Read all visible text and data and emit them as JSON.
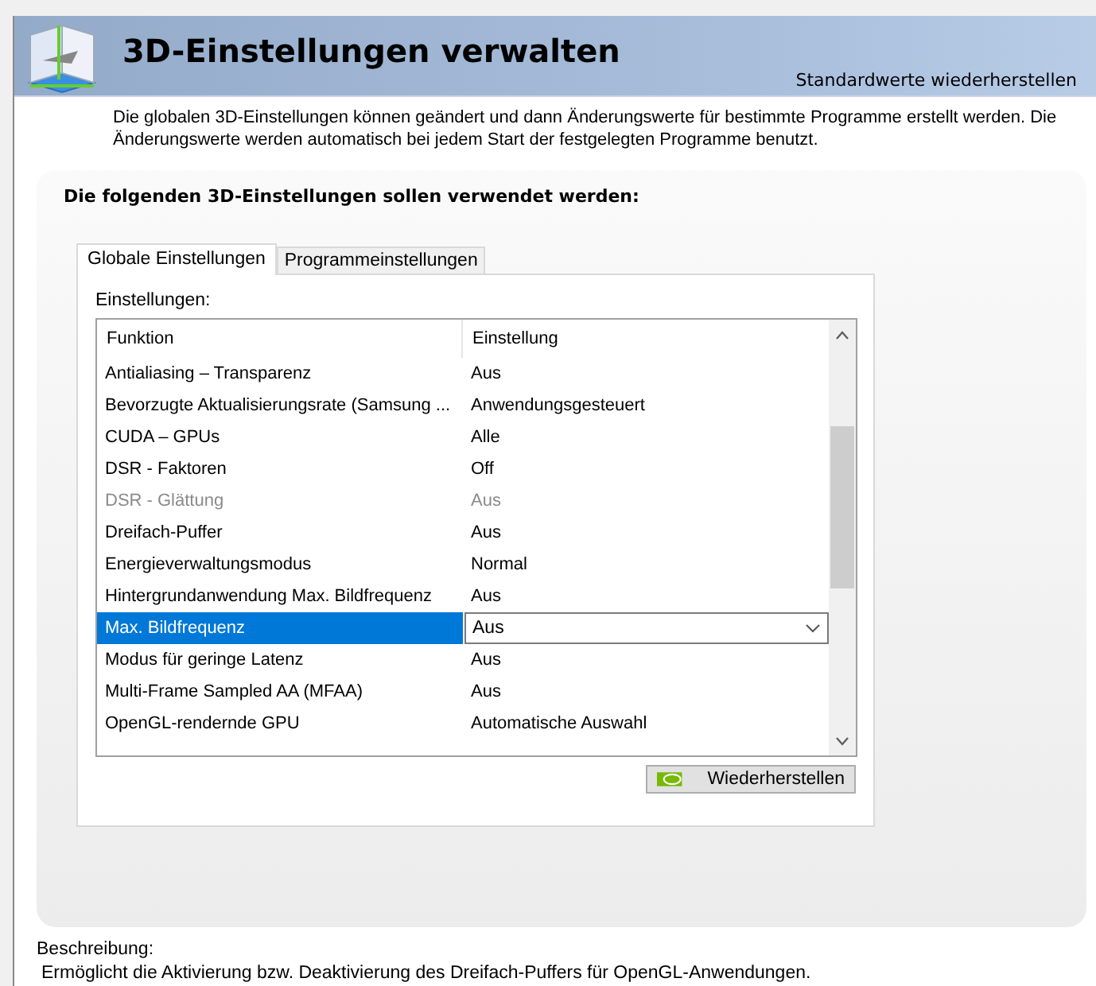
{
  "header": {
    "title": "3D-Einstellungen verwalten",
    "restore_link": "Standardwerte wiederherstellen"
  },
  "intro": "Die globalen 3D-Einstellungen können geändert und dann Änderungswerte für bestimmte Programme erstellt werden. Die Änderungswerte werden automatisch bei jedem Start der festgelegten Programme benutzt.",
  "panel_title": "Die folgenden 3D-Einstellungen sollen verwendet werden:",
  "tabs": [
    {
      "label": "Globale Einstellungen",
      "selected": true
    },
    {
      "label": "Programmeinstellungen",
      "selected": false
    }
  ],
  "settings_label": "Einstellungen:",
  "columns": [
    "Funktion",
    "Einstellung"
  ],
  "rows": [
    {
      "feature": "Antialiasing – Transparenz",
      "value": "Aus",
      "selected": false,
      "disabled": false
    },
    {
      "feature": "Bevorzugte Aktualisierungsrate (Samsung ...",
      "value": "Anwendungsgesteuert",
      "selected": false,
      "disabled": false
    },
    {
      "feature": "CUDA – GPUs",
      "value": "Alle",
      "selected": false,
      "disabled": false
    },
    {
      "feature": "DSR - Faktoren",
      "value": "Off",
      "selected": false,
      "disabled": false
    },
    {
      "feature": "DSR - Glättung",
      "value": "Aus",
      "selected": false,
      "disabled": true
    },
    {
      "feature": "Dreifach-Puffer",
      "value": "Aus",
      "selected": false,
      "disabled": false
    },
    {
      "feature": "Energieverwaltungsmodus",
      "value": "Normal",
      "selected": false,
      "disabled": false
    },
    {
      "feature": "Hintergrundanwendung Max. Bildfrequenz",
      "value": "Aus",
      "selected": false,
      "disabled": false
    },
    {
      "feature": "Max. Bildfrequenz",
      "value": "Aus",
      "selected": true,
      "disabled": false
    },
    {
      "feature": "Modus für geringe Latenz",
      "value": "Aus",
      "selected": false,
      "disabled": false
    },
    {
      "feature": "Multi-Frame Sampled AA (MFAA)",
      "value": "Aus",
      "selected": false,
      "disabled": false
    },
    {
      "feature": "OpenGL-rendernde GPU",
      "value": "Automatische Auswahl",
      "selected": false,
      "disabled": false
    }
  ],
  "restore_button": "Wiederherstellen",
  "description_label": "Beschreibung:",
  "description": "Ermöglicht die Aktivierung bzw. Deaktivierung des Dreifach-Puffers für OpenGL-Anwendungen."
}
